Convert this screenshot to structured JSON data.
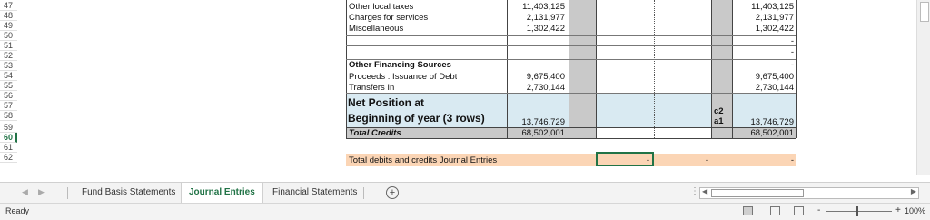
{
  "sheet": {
    "row_numbers": [
      "47",
      "48",
      "49",
      "50",
      "51",
      "52",
      "53",
      "54",
      "55",
      "56",
      "57",
      "58",
      "59",
      "60",
      "61",
      "62"
    ],
    "selected_row": "60",
    "rows": {
      "r47": {
        "label": "Other local taxes",
        "col1": "11,403,125",
        "col2": "11,403,125"
      },
      "r48": {
        "label": "Charges for services",
        "col1": "2,131,977",
        "col2": "2,131,977"
      },
      "r49": {
        "label": "Miscellaneous",
        "col1": "1,302,422",
        "col2": "1,302,422"
      },
      "r50": {
        "col2": "-"
      },
      "r51": {
        "col2": "-"
      },
      "r52": {
        "label": "Other Financing Sources",
        "col2": "-"
      },
      "r53": {
        "label": "Proceeds : Issuance of Debt",
        "col1": "9,675,400",
        "col2": "9,675,400"
      },
      "r54": {
        "label": "Transfers In",
        "col1": "2,730,144",
        "col2": "2,730,144"
      },
      "net_position": {
        "line1": "Net Position at",
        "line2": "Beginning of year (3 rows)",
        "col1": "13,746,729",
        "col2": "13,746,729",
        "note_line1": "c2",
        "note_line2": "a1"
      },
      "total_credits": {
        "label": "Total Credits",
        "col1": "68,502,001",
        "col2": "68,502,001"
      },
      "total_debits_credits": {
        "label": "Total debits and credits Journal Entries",
        "selected_value": "-",
        "value2": "-",
        "value3": "-"
      }
    }
  },
  "tabs": {
    "items": [
      {
        "label": "Fund Basis Statements"
      },
      {
        "label": "Journal Entries"
      },
      {
        "label": "Financial Statements"
      }
    ],
    "active": "Journal Entries",
    "add_symbol": "+",
    "prev_arrow": "◀",
    "next_arrow": "▶"
  },
  "status": {
    "text": "Ready",
    "zoom_minus": "-",
    "zoom_plus": "+",
    "zoom_level": "100%"
  },
  "colors": {
    "accent": "#217346",
    "gray_column": "#c9c9c9",
    "blue_fill": "#d9eaf2",
    "peach_fill": "#fbd5b5"
  }
}
